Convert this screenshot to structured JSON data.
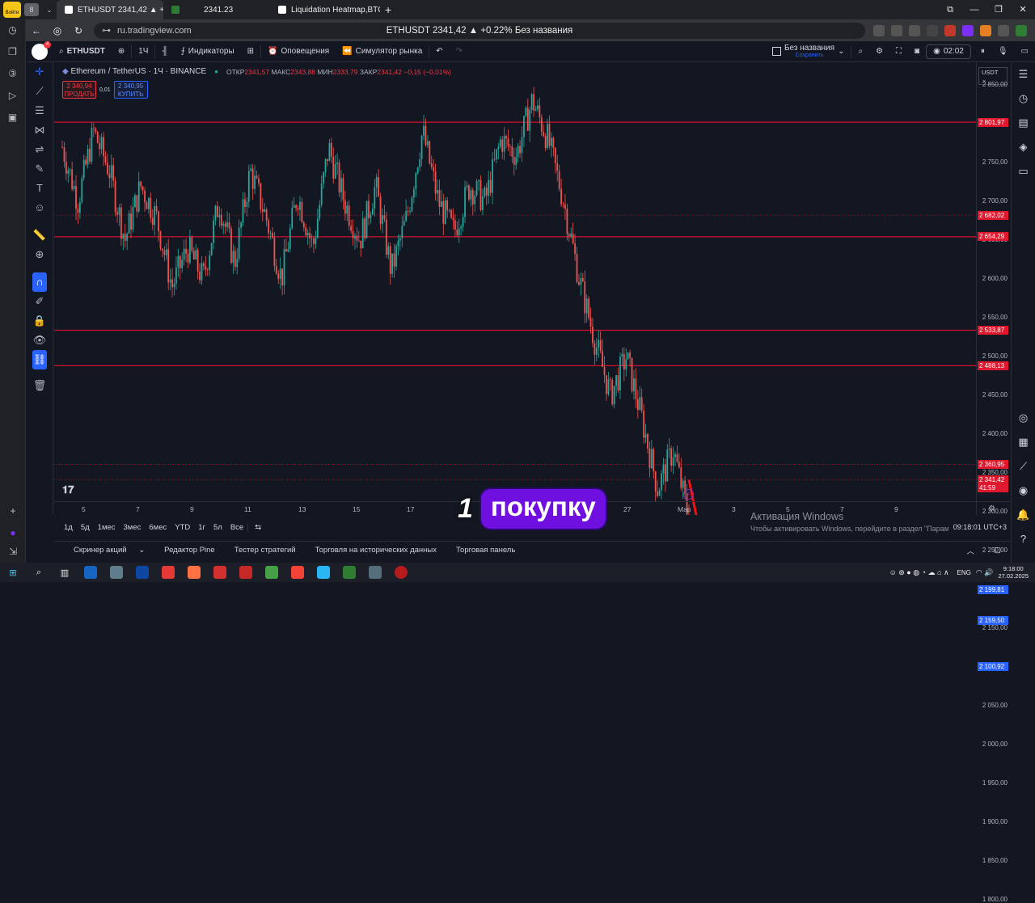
{
  "browser": {
    "tabs": [
      {
        "title": "ETHUSDT 2341,42 ▲ +0.",
        "active": true
      },
      {
        "title": "2341.23",
        "active": false
      },
      {
        "title": "Liquidation Heatmap,BTC",
        "active": false
      }
    ],
    "url": "ru.tradingview.com",
    "page_title": "ETHUSDT 2341,42 ▲ +0.22% Без названия",
    "profile_badge": "Войти"
  },
  "toolbar": {
    "symbol": "ETHUSDT",
    "interval": "1Ч",
    "indicators": "Индикаторы",
    "alerts": "Оповещения",
    "replay": "Симулятор рынка",
    "layout_name": "Без названия",
    "layout_status": "Сохранить",
    "timer": "02:02"
  },
  "legend": {
    "title": "Ethereum / TetherUS · 1Ч · BINANCE",
    "open_label": "ОТКР",
    "open": "2341,57",
    "high_label": "МАКС",
    "high": "2343,88",
    "low_label": "МИН",
    "low": "2333,79",
    "close_label": "ЗАКР",
    "close": "2341,42",
    "change": "−0,15 (−0,01%)",
    "sell_price": "2 340,94",
    "sell_label": "ПРОДАТЬ",
    "spread": "0,01",
    "buy_price": "2 340,95",
    "buy_label": "КУПИТЬ"
  },
  "chart_data": {
    "type": "line",
    "title": "Ethereum / TetherUS · 1Ч · BINANCE",
    "currency": "USDT",
    "y_ticks": [
      2850,
      2800,
      2750,
      2700,
      2650,
      2600,
      2550,
      2500,
      2450,
      2400,
      2350,
      2300,
      2250,
      2200,
      2150,
      2100,
      2050,
      2000,
      1950,
      1900,
      1850,
      1800
    ],
    "y_tick_labels": [
      "2 850,00",
      "2 800,00",
      "2 750,00",
      "2 700,00",
      "2 650,00",
      "2 600,00",
      "2 550,00",
      "2 500,00",
      "2 450,00",
      "2 400,00",
      "2 350,00",
      "2 300,00",
      "2 250,00",
      "2 200,00",
      "2 150,00",
      "2 100,00",
      "2 050,00",
      "2 000,00",
      "1 950,00",
      "1 900,00",
      "1 850,00",
      "1 800,00"
    ],
    "ylim": [
      1780,
      2880
    ],
    "x_ticks": [
      "5",
      "7",
      "9",
      "11",
      "13",
      "15",
      "17",
      "",
      "",
      "25",
      "27",
      "Мар",
      "3",
      "5",
      "7",
      "9"
    ],
    "price_labels": [
      {
        "value": 2801.97,
        "text": "2 801,97",
        "color": "#e0182d"
      },
      {
        "value": 2682.02,
        "text": "2 682,02",
        "color": "#e0182d"
      },
      {
        "value": 2654.29,
        "text": "2 654,29",
        "color": "#e0182d"
      },
      {
        "value": 2533.87,
        "text": "2 533,87",
        "color": "#e0182d"
      },
      {
        "value": 2488.13,
        "text": "2 488,13",
        "color": "#e0182d"
      },
      {
        "value": 2360.95,
        "text": "2 360,95",
        "color": "#e0182d"
      },
      {
        "value": 2341.42,
        "text": "2 341,42",
        "color": "#e0182d"
      },
      {
        "value": 2199.81,
        "text": "2 199,81",
        "color": "#2962ff"
      },
      {
        "value": 2159.5,
        "text": "2 159,50",
        "color": "#2962ff"
      },
      {
        "value": 2100.92,
        "text": "2 100,92",
        "color": "#2962ff"
      }
    ],
    "countdown": "41:59",
    "red_levels": [
      2801.97,
      2654.29,
      2533.87,
      2488.13
    ],
    "red_dotted_levels": [
      2682.02,
      2360.95,
      2341.42
    ],
    "blue_levels": [
      2159.5
    ],
    "blue_dotted_levels": [
      2199.81,
      2100.92
    ],
    "price_path": [
      2770,
      2700,
      2790,
      2740,
      2650,
      2720,
      2680,
      2590,
      2640,
      2600,
      2700,
      2620,
      2740,
      2680,
      2600,
      2710,
      2640,
      2770,
      2700,
      2650,
      2720,
      2610,
      2680,
      2790,
      2700,
      2660,
      2720,
      2700,
      2780,
      2760,
      2830,
      2780,
      2700,
      2600,
      2520,
      2450,
      2500,
      2420,
      2330,
      2380,
      2290
    ],
    "forecast_path": [
      2341,
      2210,
      2245,
      2140,
      2270,
      2200
    ]
  },
  "range": [
    "1д",
    "5д",
    "1мес",
    "3мес",
    "6мес",
    "YTD",
    "1г",
    "5л",
    "Все"
  ],
  "time_display": "09:18:01 UTC+3",
  "panels": [
    "Скринер акций",
    "Редактор Pine",
    "Тестер стратегий",
    "Торговля на исторических данных",
    "Торговая панель"
  ],
  "caption": {
    "number": "1",
    "text": "покупку"
  },
  "activation": {
    "title": "Активация Windows",
    "subtitle": "Чтобы активировать Windows, перейдите в раздел \"Параметры\"."
  },
  "taskbar": {
    "lang": "ENG",
    "time": "9:18:00",
    "date": "27.02.2025"
  }
}
